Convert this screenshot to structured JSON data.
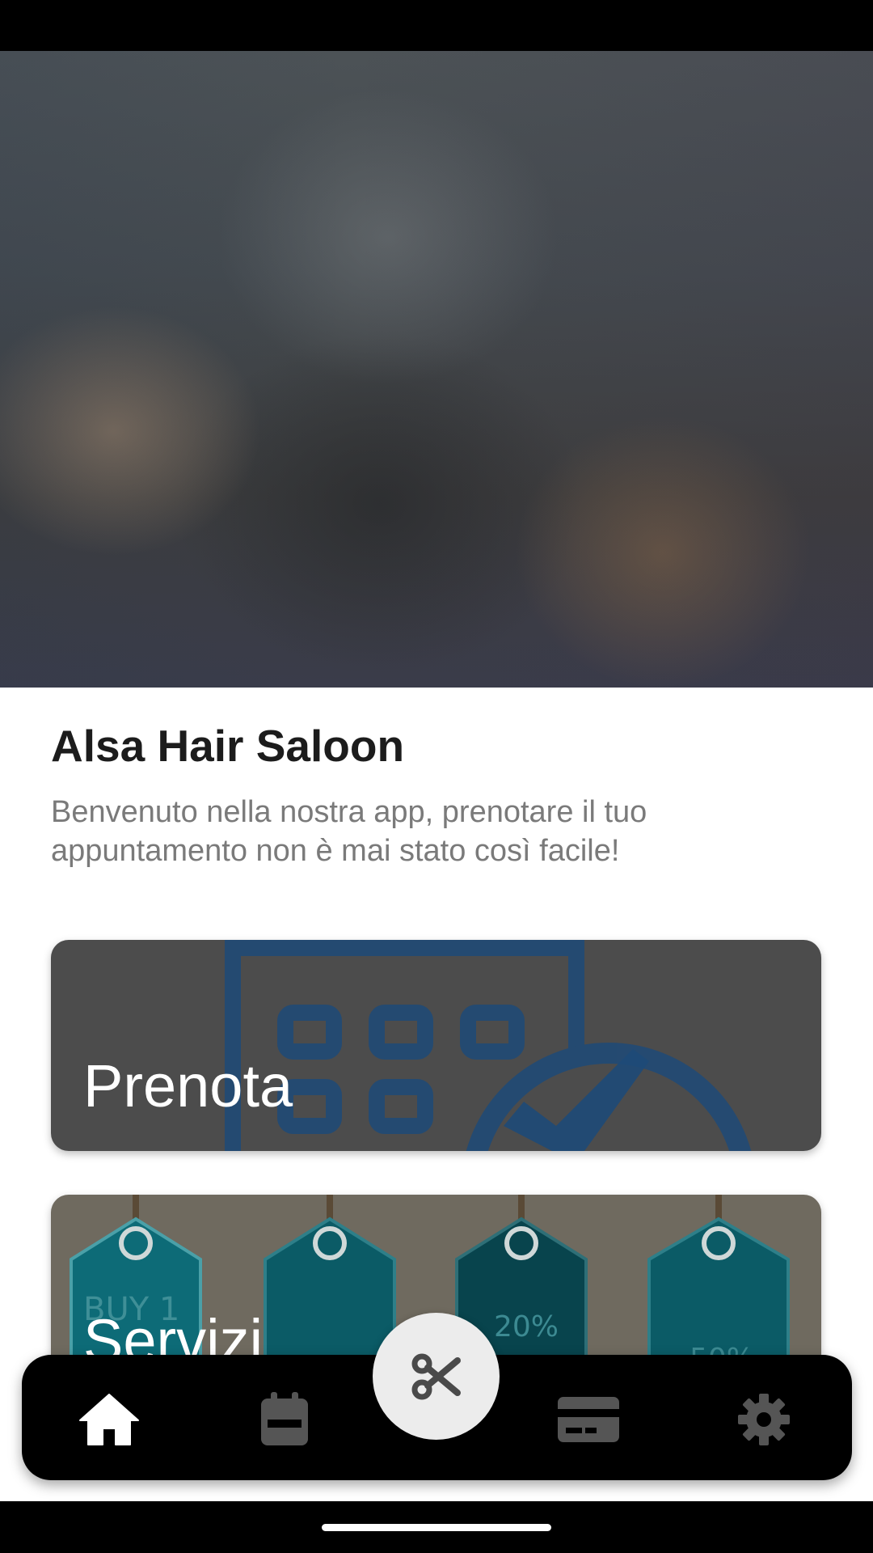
{
  "app": {
    "title": "Alsa Hair Saloon",
    "subtitle": "Benvenuto nella nostra app, prenotare il tuo appuntamento non è mai stato così facile!"
  },
  "cards": [
    {
      "label": "Prenota",
      "icon": "calendar-check-illustration",
      "background": "#4c4c4c",
      "accent": "#1e4a78"
    },
    {
      "label": "Servizi",
      "icon": "price-tags-illustration",
      "background": "#6f6a5f",
      "accent": "#0d5b66",
      "tag_texts": [
        "BUY 1",
        "20%",
        "50%"
      ]
    }
  ],
  "bottom_nav": {
    "items": [
      {
        "icon": "home-icon",
        "active": true,
        "color": "#ffffff"
      },
      {
        "icon": "calendar-icon",
        "active": false,
        "color": "#555555"
      },
      {
        "icon": "card-icon",
        "active": false,
        "color": "#555555"
      },
      {
        "icon": "gear-icon",
        "active": false,
        "color": "#555555"
      }
    ],
    "fab": {
      "icon": "scissors-icon",
      "background": "#ececec"
    }
  }
}
